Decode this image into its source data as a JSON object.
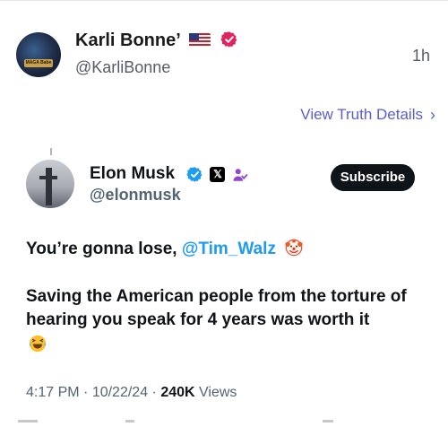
{
  "truth_post": {
    "display_name": "Karli Bonne’",
    "handle": "@KarliBonne",
    "time_ago": "1h",
    "avatar_badge_text": "MAGA Babe",
    "view_details_label": "View Truth Details",
    "chevron_glyph": "›",
    "accent_color": "#5b5bd6",
    "verified_color": "#e0245e"
  },
  "embedded_tweet": {
    "author_name": "Elon Musk",
    "author_handle": "@elonmusk",
    "subscribe_label": "Subscribe",
    "x_glyph": "𝕏",
    "line1_prefix": "You’re gonna lose, ",
    "mention": "@Tim_Walz",
    "paragraph2": "Saving the American people from the torture of hearing you speak for 4 years was worth it",
    "meta": {
      "time": "4:17 PM",
      "sep1": " · ",
      "date": "10/22/24",
      "sep2": " · ",
      "views_count": "240K",
      "views_label": " Views"
    },
    "mention_color": "#1d9bf0",
    "verified_color": "#1d9bf0"
  }
}
